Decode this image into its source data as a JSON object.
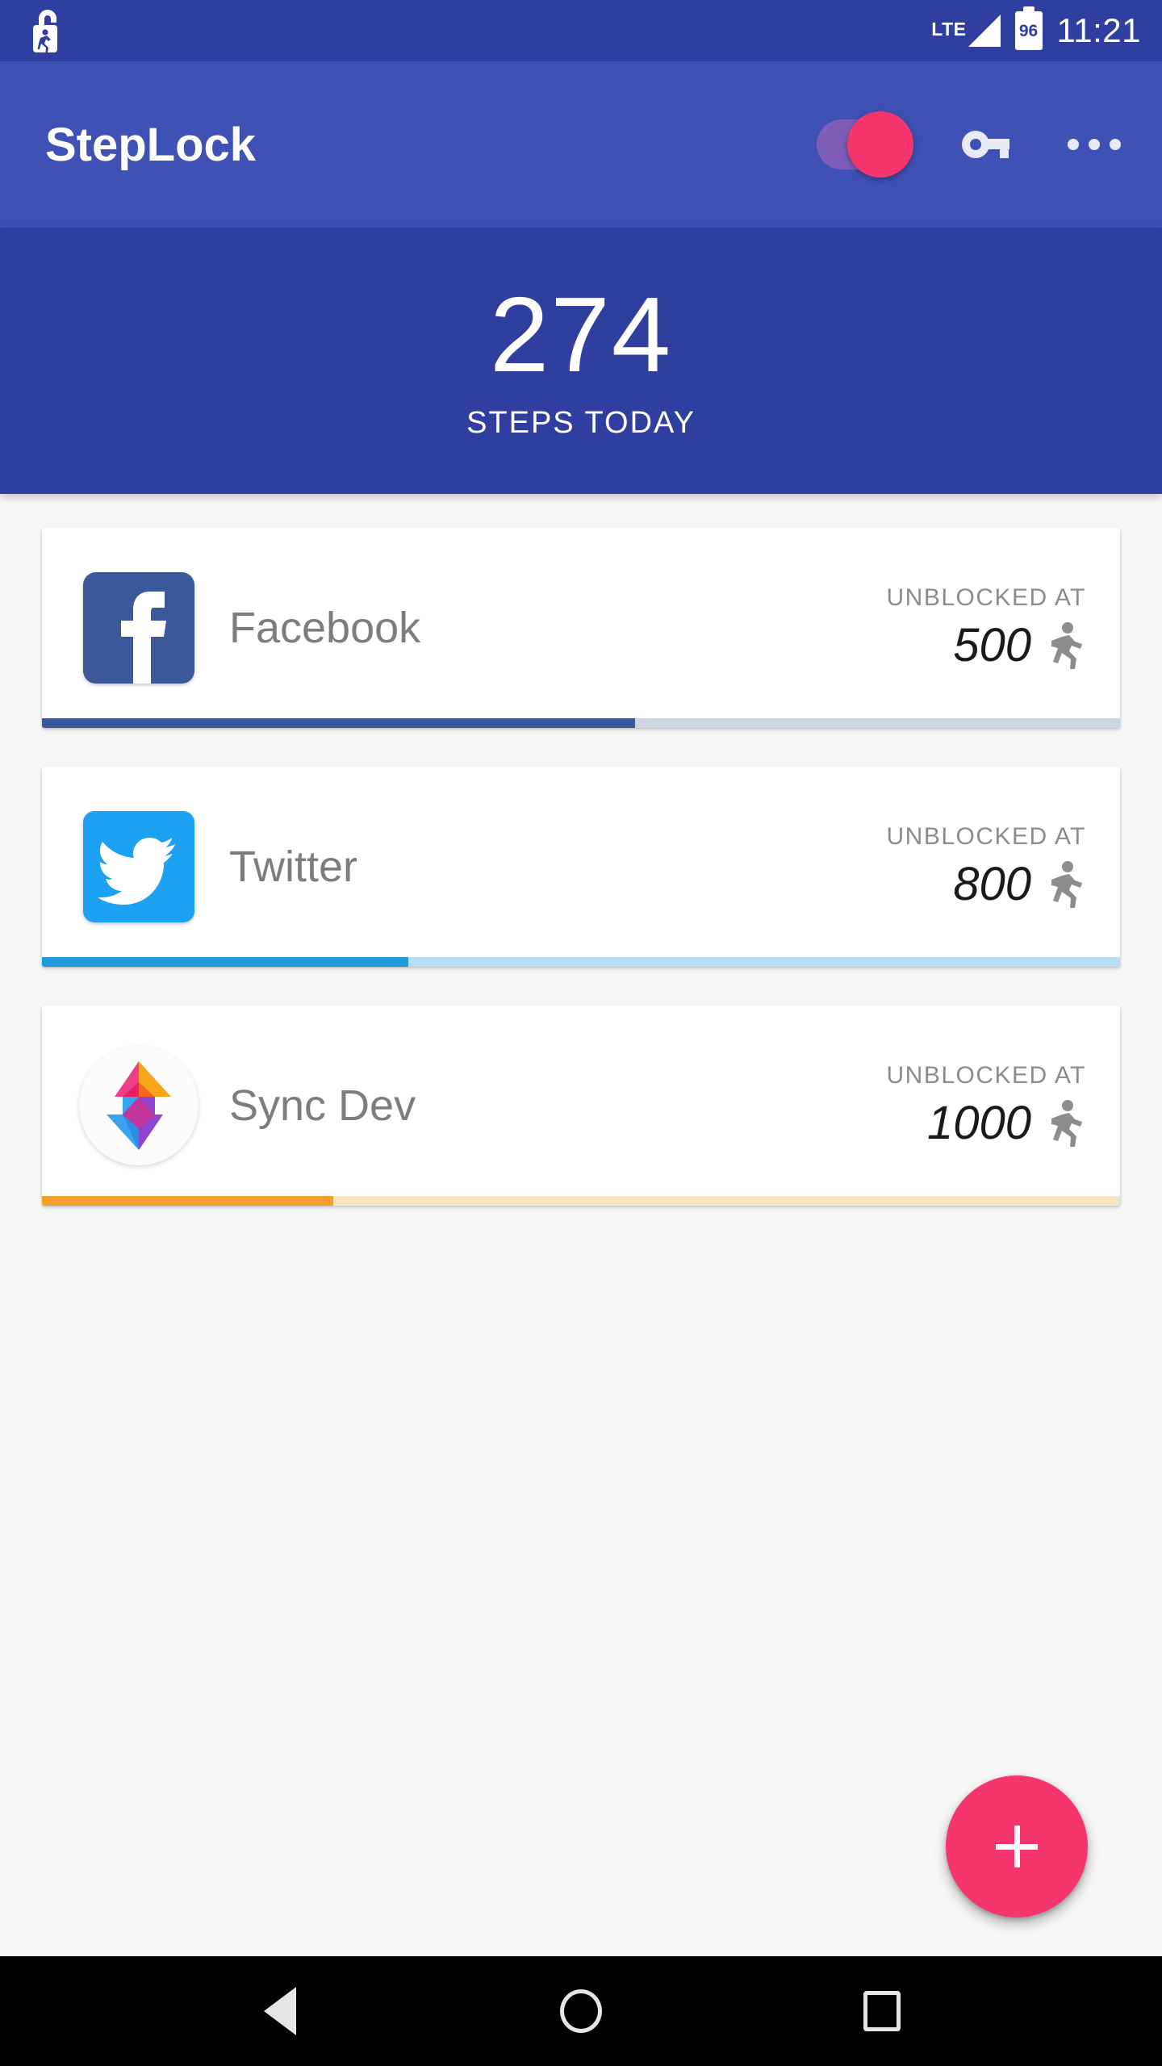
{
  "status_bar": {
    "lock_icon": "unlock-walker-icon",
    "network_type": "LTE",
    "signal_icon": "signal-bars-icon",
    "battery_icon": "battery-icon",
    "battery_level": "96",
    "time": "11:21"
  },
  "app_bar": {
    "title": "StepLock",
    "toggle": {
      "name": "blocking-toggle",
      "state": "on",
      "thumb_color": "#f5356e",
      "track_color": "#8a5fb8"
    },
    "key_icon": "key-icon",
    "overflow_icon": "overflow-menu-icon"
  },
  "step_header": {
    "count": "274",
    "label": "STEPS TODAY",
    "background_color": "#303f9f"
  },
  "apps": [
    {
      "name": "Facebook",
      "icon": "facebook-icon",
      "icon_color": "#3b5998",
      "unblocked_label": "UNBLOCKED AT",
      "goal": "500",
      "walk_icon": "walking-person-icon",
      "progress_percent": 55,
      "progress_color": "#3b5998",
      "progress_track_color": "#ccd3e3"
    },
    {
      "name": "Twitter",
      "icon": "twitter-icon",
      "icon_color": "#1da1f2",
      "unblocked_label": "UNBLOCKED AT",
      "goal": "800",
      "walk_icon": "walking-person-icon",
      "progress_percent": 34,
      "progress_color": "#1d9bd8",
      "progress_track_color": "#b9ddf3"
    },
    {
      "name": "Sync Dev",
      "icon": "sync-dev-icon",
      "icon_color": "#f5a623",
      "unblocked_label": "UNBLOCKED AT",
      "goal": "1000",
      "walk_icon": "walking-person-icon",
      "progress_percent": 27,
      "progress_color": "#f0a02a",
      "progress_track_color": "#f7e4c4"
    }
  ],
  "fab": {
    "name": "add-app-fab",
    "icon": "plus-icon",
    "color": "#f5356e"
  },
  "nav_bar": {
    "back_icon": "back-triangle-icon",
    "home_icon": "home-circle-icon",
    "recents_icon": "recents-square-icon"
  }
}
